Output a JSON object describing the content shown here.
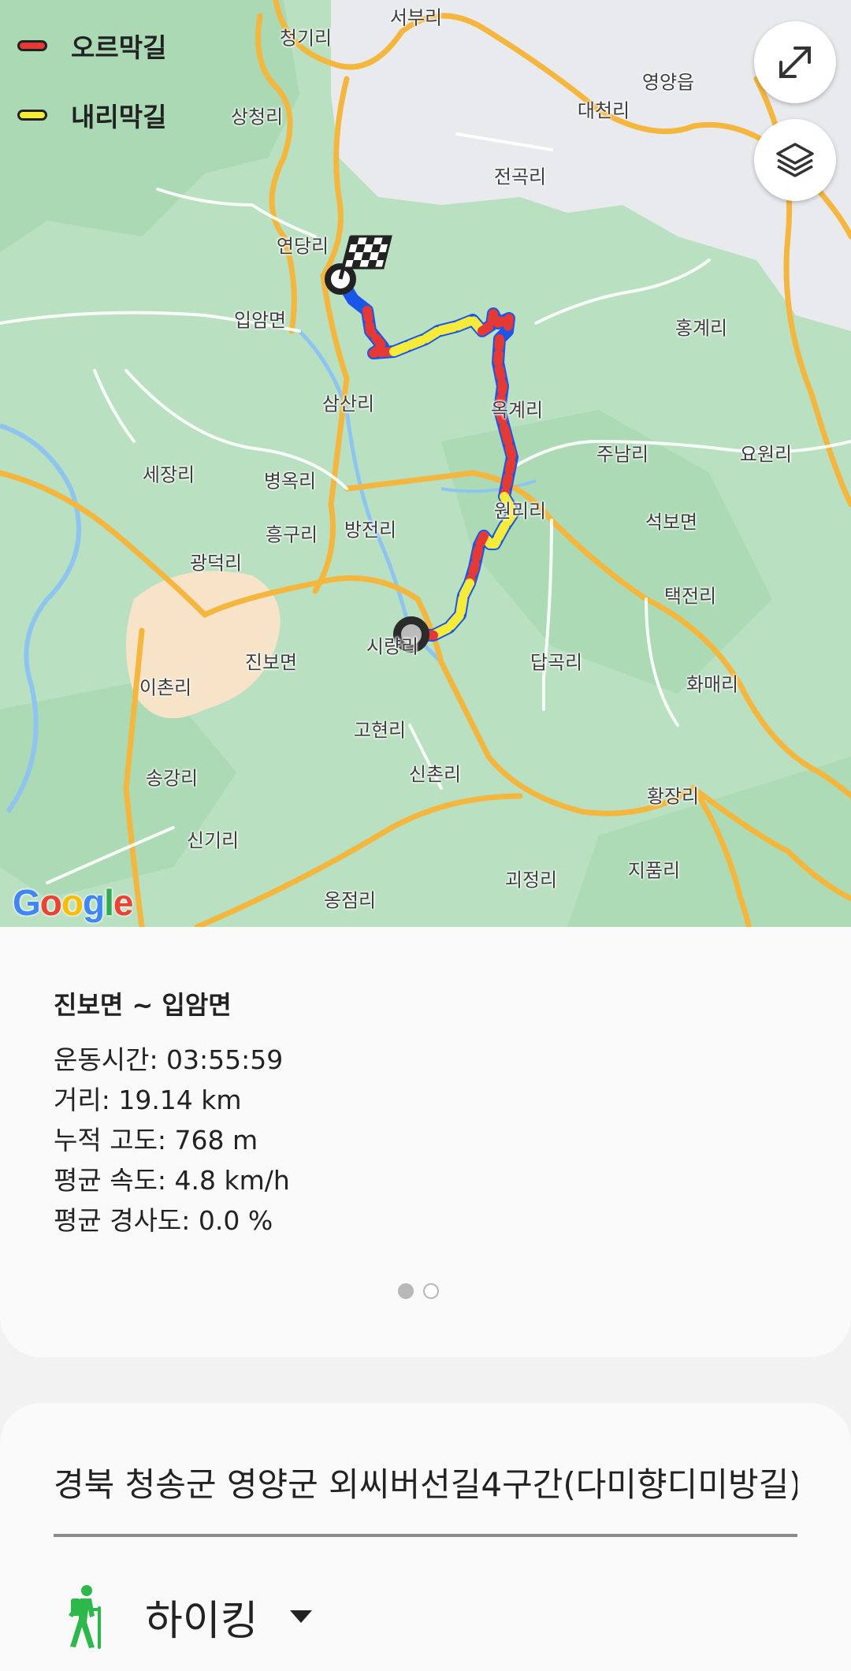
{
  "map": {
    "legend": [
      {
        "label": "오르막길",
        "color": "#e53935"
      },
      {
        "label": "내리막길",
        "color": "#f5ec3a"
      }
    ],
    "route_colors": {
      "base": "#1a56e8",
      "uphill": "#e53935",
      "downhill": "#f5ec3a"
    },
    "places": [
      "서부리",
      "청기리",
      "영양읍",
      "대천리",
      "상청리",
      "전곡리",
      "연당리",
      "입암면",
      "홍계리",
      "삼산리",
      "옥계리",
      "주남리",
      "요원리",
      "세장리",
      "병옥리",
      "원리리",
      "석보면",
      "흥구리",
      "방전리",
      "광덕리",
      "택전리",
      "시량리",
      "진보면",
      "답곡리",
      "이촌리",
      "화매리",
      "고현리",
      "송강리",
      "신촌리",
      "황장리",
      "신기리",
      "괴정리",
      "지품리",
      "옹점리"
    ],
    "google_logo": "Google",
    "buttons": {
      "expand_icon": "expand-icon",
      "layers_icon": "layers-icon"
    }
  },
  "summary": {
    "title": "진보면 ~ 입암면",
    "stats": [
      "운동시간: 03:55:59",
      "거리: 19.14 km",
      "누적 고도: 768 m",
      "평균 속도: 4.8 km/h",
      "평균 경사도: 0.0 %"
    ],
    "page_indicator": {
      "active": 1,
      "total": 2
    }
  },
  "record": {
    "name_value": "경북 청송군 영양군 외씨버선길4구간(다미향디미방길)",
    "activity_type": "하이킹"
  }
}
